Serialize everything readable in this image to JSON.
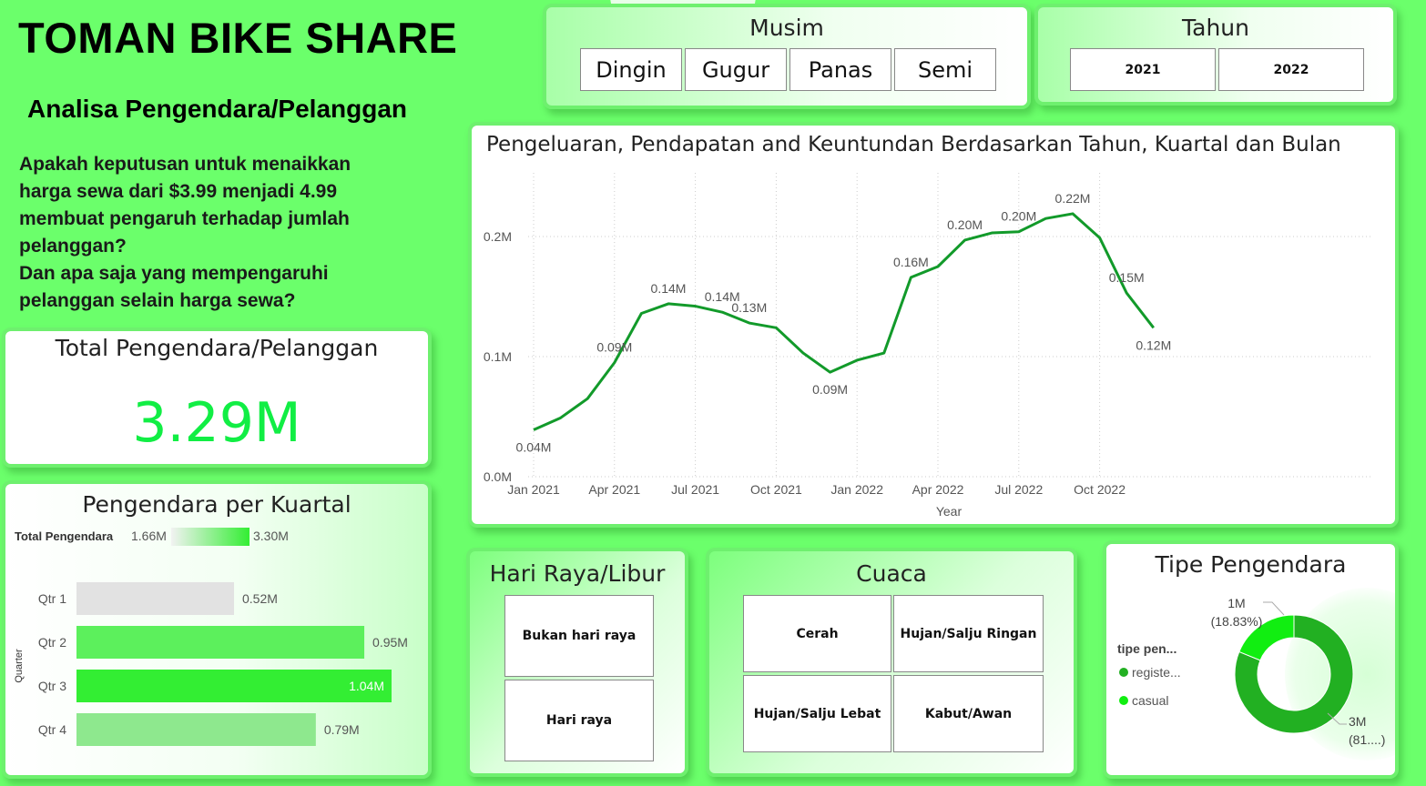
{
  "header": {
    "title": "TOMAN BIKE SHARE",
    "subtitle": "Analisa Pengendara/Pelanggan",
    "question_lines": [
      "Apakah keputusan untuk menaikkan",
      "harga sewa dari $3.99 menjadi 4.99",
      "membuat pengaruh terhadap jumlah",
      "pelanggan?",
      "Dan apa saja yang mempengaruhi",
      "pelanggan selain harga sewa?"
    ]
  },
  "musim": {
    "title": "Musim",
    "options": [
      "Dingin",
      "Gugur",
      "Panas",
      "Semi"
    ]
  },
  "tahun": {
    "title": "Tahun",
    "options": [
      "2021",
      "2022"
    ]
  },
  "total": {
    "title": "Total Pengendara/Pelanggan",
    "value": "3.29M"
  },
  "kuartal_chart": {
    "title": "Pengendara per Kuartal",
    "legend_label": "Total Pengendara",
    "legend_min": "1.66M",
    "legend_max": "3.30M",
    "axis_label": "Quarter"
  },
  "line_chart_title": "Pengeluaran, Pendapatan and Keuntundan Berdasarkan Tahun, Kuartal dan Bulan",
  "hari_raya": {
    "title": "Hari Raya/Libur",
    "options": [
      "Bukan hari raya",
      "Hari raya"
    ]
  },
  "cuaca": {
    "title": "Cuaca",
    "options": [
      "Cerah",
      "Hujan/Salju Ringan",
      "Hujan/Salju Lebat",
      "Kabut/Awan"
    ]
  },
  "tipe": {
    "title": "Tipe Pengendara",
    "legend_title": "tipe pen...",
    "legend": [
      "registe...",
      "casual"
    ],
    "label_casual_value": "1M",
    "label_casual_pct": "(18.83%)",
    "label_reg_value": "3M",
    "label_reg_pct": "(81....)"
  },
  "colors": {
    "line": "#129a2a",
    "donut_registered": "#22b022",
    "donut_casual": "#11ee11"
  },
  "chart_data": [
    {
      "type": "line",
      "title": "Pengeluaran, Pendapatan and Keuntundan Berdasarkan Tahun, Kuartal dan Bulan",
      "xlabel": "Year",
      "ylabel": "",
      "x_ticks": [
        "Jan 2021",
        "Apr 2021",
        "Jul 2021",
        "Oct 2021",
        "Jan 2022",
        "Apr 2022",
        "Jul 2022",
        "Oct 2022"
      ],
      "y_ticks": [
        "0.0M",
        "0.1M",
        "0.2M"
      ],
      "ylim": [
        0,
        0.2
      ],
      "grid": true,
      "x": [
        "2021-01",
        "2021-02",
        "2021-03",
        "2021-04",
        "2021-05",
        "2021-06",
        "2021-07",
        "2021-08",
        "2021-09",
        "2021-10",
        "2021-11",
        "2021-12",
        "2022-01",
        "2022-02",
        "2022-03",
        "2022-04",
        "2022-05",
        "2022-06",
        "2022-07",
        "2022-08",
        "2022-09",
        "2022-10",
        "2022-11",
        "2022-12"
      ],
      "values": [
        0.039,
        0.049,
        0.065,
        0.095,
        0.136,
        0.144,
        0.142,
        0.137,
        0.128,
        0.124,
        0.103,
        0.087,
        0.097,
        0.103,
        0.166,
        0.175,
        0.197,
        0.203,
        0.204,
        0.215,
        0.219,
        0.199,
        0.153,
        0.124
      ],
      "data_labels": [
        {
          "index": 0,
          "text": "0.04M",
          "pos": "below"
        },
        {
          "index": 3,
          "text": "0.09M",
          "pos": "above"
        },
        {
          "index": 5,
          "text": "0.14M",
          "pos": "above"
        },
        {
          "index": 7,
          "text": "0.14M",
          "pos": "above"
        },
        {
          "index": 8,
          "text": "0.13M",
          "pos": "above"
        },
        {
          "index": 11,
          "text": "0.09M",
          "pos": "below"
        },
        {
          "index": 14,
          "text": "0.16M",
          "pos": "above"
        },
        {
          "index": 16,
          "text": "0.20M",
          "pos": "above"
        },
        {
          "index": 18,
          "text": "0.20M",
          "pos": "above"
        },
        {
          "index": 20,
          "text": "0.22M",
          "pos": "above"
        },
        {
          "index": 22,
          "text": "0.15M",
          "pos": "above"
        },
        {
          "index": 23,
          "text": "0.12M",
          "pos": "below"
        }
      ]
    },
    {
      "type": "bar",
      "title": "Pengendara per Kuartal",
      "ylabel": "Quarter",
      "categories": [
        "Qtr 1",
        "Qtr 2",
        "Qtr 3",
        "Qtr 4"
      ],
      "values": [
        0.52,
        0.95,
        1.04,
        0.79
      ],
      "value_labels": [
        "0.52M",
        "0.95M",
        "1.04M",
        "0.79M"
      ],
      "colors": [
        "#e2e2e2",
        "#5cf05c",
        "#33ee33",
        "#8ee88e"
      ],
      "xlim": [
        0,
        1.04
      ]
    },
    {
      "type": "pie",
      "title": "Tipe Pengendara",
      "labels": [
        "registered",
        "casual"
      ],
      "values": [
        81.17,
        18.83
      ]
    }
  ]
}
